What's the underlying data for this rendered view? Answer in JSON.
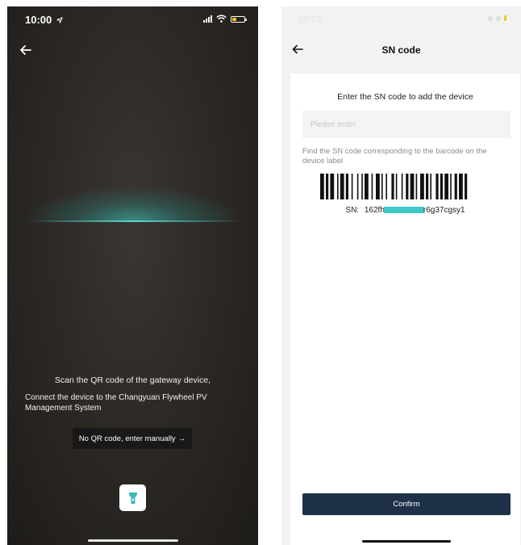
{
  "scanner": {
    "status_time": "10:00",
    "instruction_line1": "Scan the QR code of the gateway device,",
    "instruction_line2": "Connect the device to the Changyuan Flywheel PV Management System",
    "manual_entry_label": "No QR code, enter manually",
    "manual_entry_arrow": "→",
    "icons": [
      "location-arrow-icon",
      "signal-icon",
      "wifi-icon",
      "battery-icon",
      "back-arrow-icon",
      "flashlight-icon"
    ]
  },
  "sn_screen": {
    "status_time": "10:01",
    "title": "SN code",
    "heading": "Enter the SN code to add the device",
    "input": {
      "value": "",
      "placeholder": "Please enter"
    },
    "hint": "Find the SN code corresponding to the barcode on the device label",
    "sn_label": "SN:",
    "sn_prefix": "162fh",
    "sn_suffix": "r6g37cgsy1",
    "confirm_label": "Confirm",
    "icons": [
      "back-arrow-icon",
      "barcode-icon"
    ]
  },
  "colors": {
    "scan_accent": "#3ccbc6",
    "confirm_button": "#1f3149",
    "flash_icon": "#3bb8b3"
  }
}
